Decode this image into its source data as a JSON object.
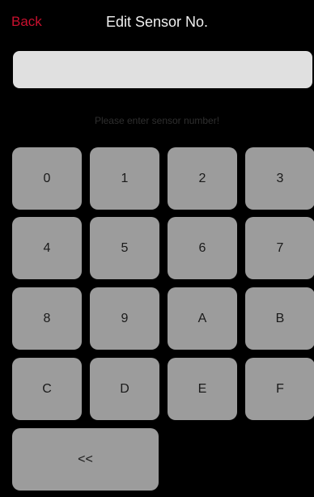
{
  "header": {
    "back_label": "Back",
    "title": "Edit Sensor No."
  },
  "entry": {
    "value": "",
    "hint": "Please enter sensor number!"
  },
  "keypad": {
    "keys": [
      "0",
      "1",
      "2",
      "3",
      "4",
      "5",
      "6",
      "7",
      "8",
      "9",
      "A",
      "B",
      "C",
      "D",
      "E",
      "F"
    ],
    "backspace_label": "<<"
  },
  "colors": {
    "background": "#000000",
    "accent": "#c8102e",
    "key_face": "#9c9c9c",
    "input_field": "#e0e0e0"
  }
}
